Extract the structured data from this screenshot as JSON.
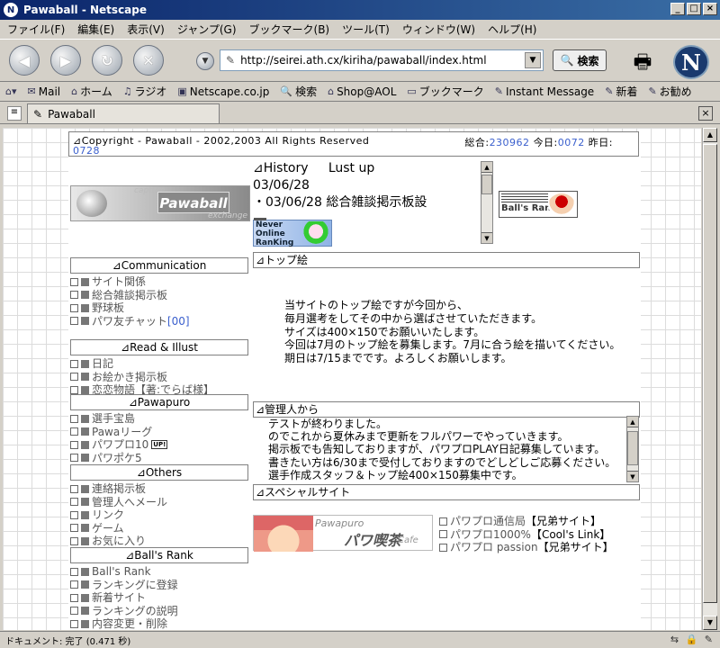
{
  "window": {
    "title": "Pawaball - Netscape",
    "controls": [
      "_",
      "□",
      "×"
    ]
  },
  "menu": [
    "ファイル(F)",
    "編集(E)",
    "表示(V)",
    "ジャンプ(G)",
    "ブックマーク(B)",
    "ツール(T)",
    "ウィンドウ(W)",
    "ヘルプ(H)"
  ],
  "nav": {
    "url": "http://seirei.ath.cx/kiriha/pawaball/index.html",
    "search_label": "検索"
  },
  "bookmarks": [
    "Mail",
    "ホーム",
    "ラジオ",
    "Netscape.co.jp",
    "検索",
    "Shop@AOL",
    "ブックマーク",
    "Instant Message",
    "新着",
    "お勧め"
  ],
  "tab": {
    "label": "Pawaball"
  },
  "header": {
    "copyright": "⊿Copyright - Pawaball - 2002,2003  All Rights Reserved",
    "total_label": "総合:",
    "total_value": "230962",
    "today_label": "今日:",
    "today_value": "0072",
    "yesterday_label": "昨日:",
    "yesterday_value": "0728"
  },
  "logo": {
    "top": "capture",
    "main": "Pawaball",
    "bottom": "exchange"
  },
  "history": {
    "title": "⊿History",
    "subtitle": "Lust up",
    "date": "03/06/28",
    "entry": "・03/06/28  総合雑談掲示板設"
  },
  "banners": {
    "balls_rank": "Ball's Rank",
    "never_online": [
      "Never",
      "Online",
      "RanKing"
    ]
  },
  "sidebar": {
    "communication": {
      "title": "⊿Communication",
      "items": [
        "サイト関係",
        "総合雑談掲示板",
        "野球板",
        "パワ友チャット"
      ],
      "chat_suffix": "[00]"
    },
    "read_illust": {
      "title": "⊿Read & Illust",
      "items": [
        "日記",
        "お絵かき掲示板",
        "恋恋物語【著:でらば様】"
      ]
    },
    "pawapuro": {
      "title": "⊿Pawapuro",
      "items": [
        "選手宝島",
        "Pawaリーグ",
        "パワプロ10",
        "パワポケ5"
      ],
      "up_badge": "UP!"
    },
    "others": {
      "title": "⊿Others",
      "items": [
        "連絡掲示板",
        "管理人へメール",
        "リンク",
        "ゲーム",
        "お気に入り"
      ]
    },
    "balls_rank": {
      "title": "⊿Ball's Rank",
      "items": [
        "Ball's Rank",
        "ランキングに登録",
        "新着サイト",
        "ランキングの説明",
        "内容変更・削除"
      ]
    }
  },
  "top_illust": {
    "title": "⊿トップ絵",
    "lines": [
      "当サイトのトップ絵ですが今回から、",
      "毎月選考をしてその中から選ばさせていただきます。",
      "サイズは400×150でお願いいたします。",
      "今回は7月のトップ絵を募集します。7月に合う絵を描いてください。",
      "期日は7/15までです。よろしくお願いします。"
    ]
  },
  "admin": {
    "title": "⊿管理人から",
    "lines": [
      "テストが終わりました。",
      "のでこれから夏休みまで更新をフルパワーでやっていきます。",
      "掲示板でも告知しておりますが、パワプロPLAY日記募集しています。",
      "書きたい方は6/30まで受付しておりますのでどしどしご応募ください。",
      "選手作成スタッフ＆トップ絵400×150募集中です。"
    ]
  },
  "special": {
    "title": "⊿スペシャルサイト",
    "banner": {
      "small": "Pawapuro",
      "main": "パワ喫茶",
      "cafe": "Cafe"
    },
    "links": [
      {
        "name": "パワプロ通信局",
        "note": "【兄弟サイト】"
      },
      {
        "name": "パワプロ1000%",
        "note": "【Cool's Link】"
      },
      {
        "name": "パワプロ passion",
        "note": "【兄弟サイト】"
      }
    ]
  },
  "status": {
    "text": "ドキュメント: 完了 (0.471 秒)"
  }
}
